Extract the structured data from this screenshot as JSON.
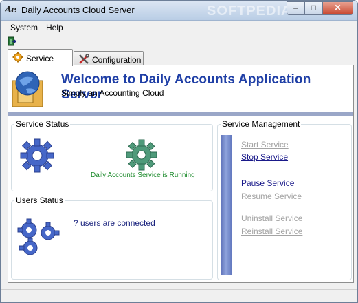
{
  "window": {
    "title": "Daily Accounts Cloud Server",
    "icon_text": "Ae",
    "buttons": {
      "minimize": "–",
      "maximize": "□",
      "close": "✕"
    }
  },
  "menu": {
    "items": [
      "System",
      "Help"
    ]
  },
  "tabs": [
    {
      "label": "Service",
      "icon": "gear-icon",
      "selected": true
    },
    {
      "label": "Configuration",
      "icon": "tools-icon",
      "selected": false
    }
  ],
  "banner": {
    "title": "Welcome to Daily Accounts Application Server",
    "subtitle": "Simply an Accounting Cloud"
  },
  "service_status": {
    "title": "Service Status",
    "message": "Daily Accounts Service is Running"
  },
  "users_status": {
    "title": "Users Status",
    "message": "? users are connected"
  },
  "service_management": {
    "title": "Service Management",
    "actions": [
      {
        "label": "Start Service",
        "enabled": false
      },
      {
        "label": "Stop Service",
        "enabled": true
      },
      {
        "label": "Pause Service",
        "enabled": true
      },
      {
        "label": "Resume Service",
        "enabled": false
      },
      {
        "label": "Uninstall Service",
        "enabled": false
      },
      {
        "label": "Reinstall Service",
        "enabled": false
      }
    ]
  },
  "colors": {
    "title_blue": "#1f3fa6",
    "running_green": "#1c8a2b",
    "link_blue": "#1a1a8a",
    "disabled_gray": "#a4a4a4"
  }
}
